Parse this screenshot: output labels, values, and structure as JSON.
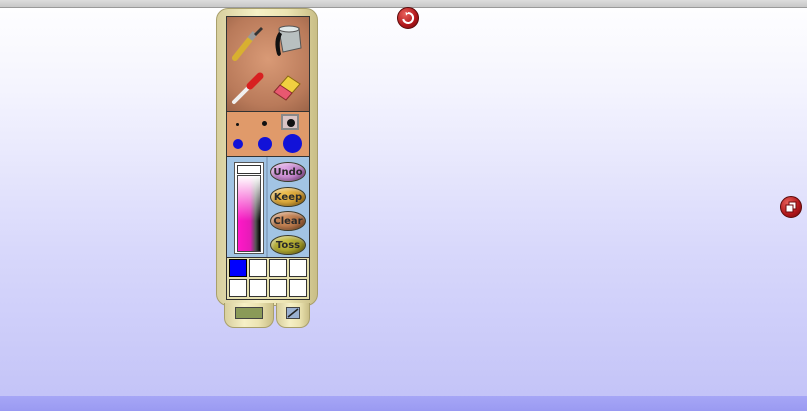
{
  "window": {
    "title_bar": "",
    "bottom_bar": ""
  },
  "top_button": {
    "icon": "refresh-icon"
  },
  "side_button": {
    "icon": "restore-window-icon"
  },
  "palette": {
    "tools": [
      {
        "name": "brush",
        "icon": "paintbrush-icon"
      },
      {
        "name": "bucket",
        "icon": "paint-bucket-icon"
      },
      {
        "name": "dropper",
        "icon": "eyedropper-icon"
      },
      {
        "name": "eraser",
        "icon": "eraser-icon"
      }
    ],
    "brush_sizes_small": [
      "tiny",
      "small",
      "medium"
    ],
    "brush_sizes_large": [
      "large",
      "larger",
      "largest"
    ],
    "selected_size_index": 2,
    "brush_color": "#1212d8",
    "gradient_colors": [
      "#ffffff",
      "#ff18c8",
      "#000000"
    ],
    "buttons": {
      "undo": "Undo",
      "keep": "Keep",
      "clear": "Clear",
      "toss": "Toss"
    },
    "swatches": [
      "#0000ff",
      "#ffffff",
      "#ffffff",
      "#ffffff",
      "#ffffff",
      "#ffffff",
      "#ffffff",
      "#ffffff"
    ],
    "selected_swatch_index": 0,
    "bottom_tabs": [
      {
        "icon": "drawing-thumbnail-icon"
      },
      {
        "icon": "pen-icon"
      }
    ]
  }
}
